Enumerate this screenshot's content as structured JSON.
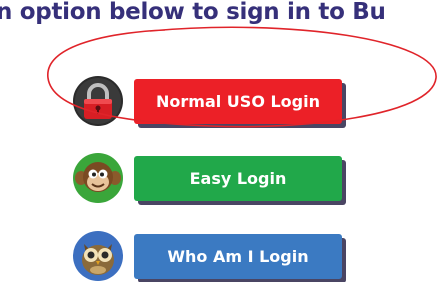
{
  "prompt": {
    "text": "n option below to sign in to Bu"
  },
  "logins": [
    {
      "label": "Normal USO Login",
      "icon": "padlock-icon",
      "color": "#ec2027"
    },
    {
      "label": "Easy Login",
      "icon": "monkey-icon",
      "color": "#21a84a"
    },
    {
      "label": "Who Am I Login",
      "icon": "owl-icon",
      "color": "#3b7ac2"
    }
  ],
  "colors": {
    "heading": "#36307a",
    "annotation": "#e0242a",
    "shadow": "#4a4563"
  }
}
